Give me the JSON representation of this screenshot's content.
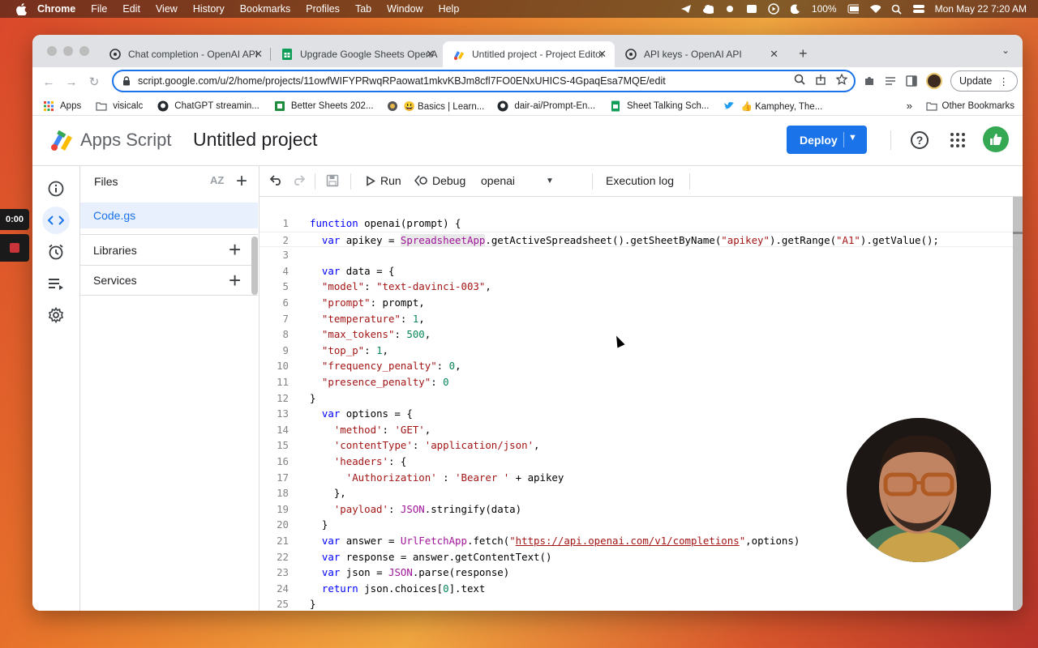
{
  "macos": {
    "menus": [
      "Chrome",
      "File",
      "Edit",
      "View",
      "History",
      "Bookmarks",
      "Profiles",
      "Tab",
      "Window",
      "Help"
    ],
    "battery": "100%",
    "datetime": "Mon May 22  7:20 AM"
  },
  "browser": {
    "tabs": [
      {
        "title": "Chat completion - OpenAI API",
        "icon": "openai-icon"
      },
      {
        "title": "Upgrade Google Sheets OpenAI",
        "icon": "sheets-icon"
      },
      {
        "title": "Untitled project - Project Editor",
        "icon": "apps-script-icon"
      },
      {
        "title": "API keys - OpenAI API",
        "icon": "openai-icon"
      }
    ],
    "url": "script.google.com/u/2/home/projects/11owfWIFYPRwqRPaowat1mkvKBJm8cfl7FO0ENxUHICS-4GpaqEsa7MQE/edit",
    "update_label": "Update",
    "bookmarks": [
      {
        "label": "Apps",
        "icon": "apps-grid-icon"
      },
      {
        "label": "visicalc",
        "icon": "folder-icon"
      },
      {
        "label": "ChatGPT streamin...",
        "icon": "github-icon"
      },
      {
        "label": "Better Sheets 202...",
        "icon": "better-sheets-icon"
      },
      {
        "label": "😃 Basics | Learn...",
        "icon": "globe-icon"
      },
      {
        "label": "dair-ai/Prompt-En...",
        "icon": "github-icon"
      },
      {
        "label": "Sheet Talking Sch...",
        "icon": "sheets-icon"
      },
      {
        "label": "👍 Kamphey, The...",
        "icon": "twitter-icon"
      }
    ],
    "other_bookmarks": "Other Bookmarks"
  },
  "app": {
    "product_name": "Apps Script",
    "project_title": "Untitled project",
    "deploy_label": "Deploy"
  },
  "files_panel": {
    "header": "Files",
    "files": [
      "Code.gs"
    ],
    "libraries_label": "Libraries",
    "services_label": "Services"
  },
  "editor_toolbar": {
    "run_label": "Run",
    "debug_label": "Debug",
    "function_select": "openai",
    "execution_log_label": "Execution log"
  },
  "code_lines": [
    "function openai(prompt) {",
    "  var apikey = SpreadsheetApp.getActiveSpreadsheet().getSheetByName(\"apikey\").getRange(\"A1\").getValue();",
    "",
    "  var data = {",
    "  \"model\": \"text-davinci-003\",",
    "  \"prompt\": prompt,",
    "  \"temperature\": 1,",
    "  \"max_tokens\": 500,",
    "  \"top_p\": 1,",
    "  \"frequency_penalty\": 0,",
    "  \"presence_penalty\": 0",
    "}",
    "  var options = {",
    "    'method': 'GET',",
    "    'contentType': 'application/json',",
    "    'headers': {",
    "      'Authorization' : 'Bearer ' + apikey",
    "    },",
    "    'payload': JSON.stringify(data)",
    "  }",
    "  var answer = UrlFetchApp.fetch(\"https://api.openai.com/v1/completions\",options)",
    "  var response = answer.getContentText()",
    "  var json = JSON.parse(response)",
    "  return json.choices[0].text",
    "}"
  ],
  "line_numbers": [
    "1",
    "2",
    "3",
    "4",
    "5",
    "6",
    "7",
    "8",
    "9",
    "10",
    "11",
    "12",
    "13",
    "14",
    "15",
    "16",
    "17",
    "18",
    "19",
    "20",
    "21",
    "22",
    "23",
    "24",
    "25"
  ],
  "recording": {
    "timer": "0:00"
  },
  "colors": {
    "accent": "#1a73e8",
    "keyword": "#0000ff",
    "string": "#a31515",
    "number": "#098658",
    "class": "#a0149a"
  }
}
